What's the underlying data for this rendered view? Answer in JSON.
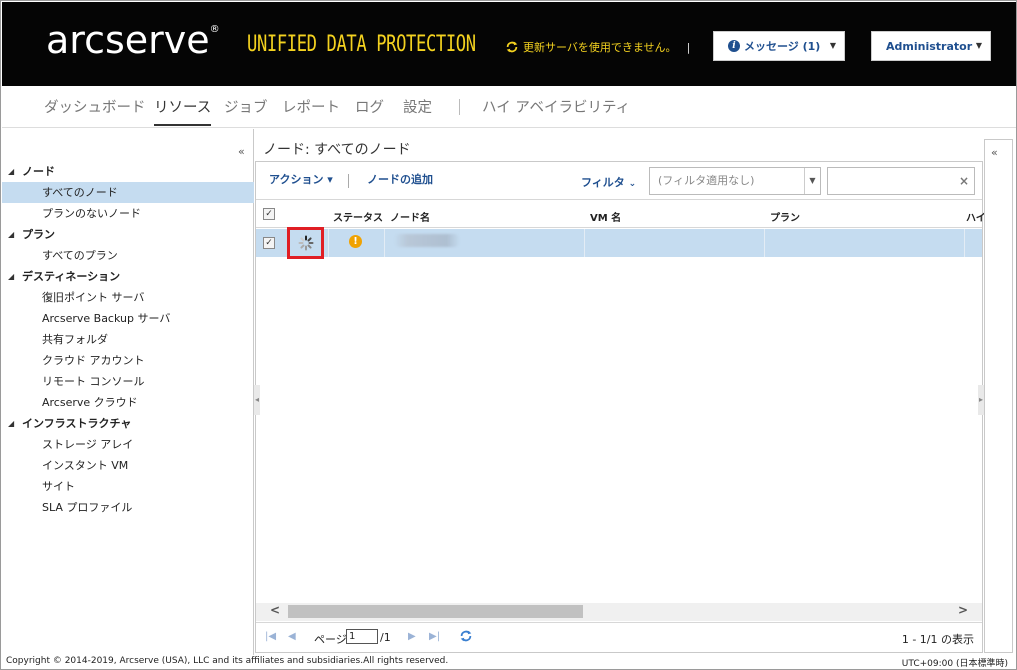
{
  "header": {
    "logo": "arcserve",
    "logo_mark": "®",
    "product": "UNIFIED DATA PROTECTION",
    "update_message": "更新サーバを使用できません。",
    "update_separator": "|",
    "messages_label": "メッセージ (1)",
    "admin_label": "Administrator"
  },
  "nav": {
    "dashboard": "ダッシュボード",
    "resources": "リソース",
    "jobs": "ジョブ",
    "reports": "レポート",
    "logs": "ログ",
    "settings": "設定",
    "high_availability": "ハイ アベイラビリティ"
  },
  "sidebar": {
    "collapse": "«",
    "groups": [
      {
        "label": "ノード",
        "items": [
          "すべてのノード",
          "プランのないノード"
        ]
      },
      {
        "label": "プラン",
        "items": [
          "すべてのプラン"
        ]
      },
      {
        "label": "デスティネーション",
        "items": [
          "復旧ポイント サーバ",
          "Arcserve Backup サーバ",
          "共有フォルダ",
          "クラウド アカウント",
          "リモート コンソール",
          "Arcserve クラウド"
        ]
      },
      {
        "label": "インフラストラクチャ",
        "items": [
          "ストレージ アレイ",
          "インスタント VM",
          "サイト",
          "SLA プロファイル"
        ]
      }
    ],
    "selected_item": "すべてのノード"
  },
  "main": {
    "title": "ノード: すべてのノード",
    "toolbar": {
      "action": "アクション ▾",
      "add_node": "ノードの追加",
      "filter": "フィルタ",
      "filter_select": "(フィルタ適用なし)",
      "search_value": ""
    },
    "columns": [
      "ステータス",
      "ノード名",
      "VM 名",
      "プラン",
      "ハイ"
    ],
    "rows": [
      {
        "status": "warning",
        "node_name": "",
        "vm_name": "",
        "plan": "",
        "selected": true,
        "loading": true
      }
    ],
    "pager": {
      "page_label": "ページ",
      "page_value": "1",
      "total": "/1",
      "info": "1 - 1/1 の表示"
    }
  },
  "footer": {
    "copyright": "Copyright © 2014-2019, Arcserve (USA), LLC and its affiliates and subsidiaries.All rights reserved.",
    "timezone": "UTC+09:00 (日本標準時)"
  },
  "colors": {
    "header_bg": "#050505",
    "product_yellow": "#f4d21f",
    "link_blue": "#1f4f8f",
    "selection": "#c5dcf0",
    "highlight_red": "#e01e24",
    "warning": "#f0a202"
  }
}
